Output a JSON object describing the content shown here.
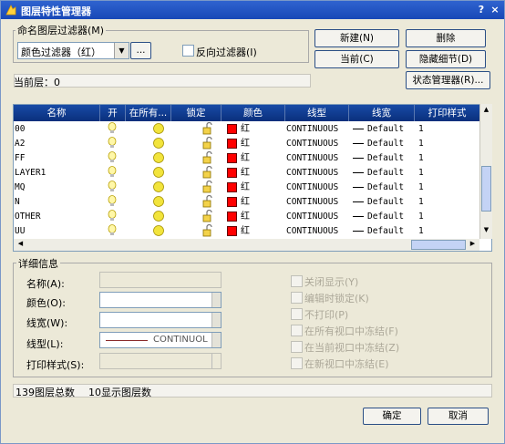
{
  "window": {
    "title": "图层特性管理器",
    "help": "?",
    "close": "×"
  },
  "filters": {
    "group_label": "命名图层过滤器(M)",
    "selected": "颜色过滤器（红）",
    "browse_label": "...",
    "invert_label": "反向过滤器(I)"
  },
  "buttons": {
    "new": "新建(N)",
    "delete": "删除",
    "current": "当前(C)",
    "hide_details": "隐藏细节(D)",
    "state_manager": "状态管理器(R)...",
    "ok": "确定",
    "cancel": "取消"
  },
  "current_layer_text": "当前层：0",
  "grid": {
    "columns": [
      "名称",
      "开",
      "在所有...",
      "锁定",
      "颜色",
      "线型",
      "线宽",
      "打印样式"
    ],
    "rows": [
      {
        "name": "00",
        "color": "红",
        "linetype": "CONTINUOUS",
        "lineweight": "Default",
        "plot": "1"
      },
      {
        "name": "A2",
        "color": "红",
        "linetype": "CONTINUOUS",
        "lineweight": "Default",
        "plot": "1"
      },
      {
        "name": "FF",
        "color": "红",
        "linetype": "CONTINUOUS",
        "lineweight": "Default",
        "plot": "1"
      },
      {
        "name": "LAYER1",
        "color": "红",
        "linetype": "CONTINUOUS",
        "lineweight": "Default",
        "plot": "1"
      },
      {
        "name": "MQ",
        "color": "红",
        "linetype": "CONTINUOUS",
        "lineweight": "Default",
        "plot": "1"
      },
      {
        "name": "N",
        "color": "红",
        "linetype": "CONTINUOUS",
        "lineweight": "Default",
        "plot": "1"
      },
      {
        "name": "OTHER",
        "color": "红",
        "linetype": "CONTINUOUS",
        "lineweight": "Default",
        "plot": "1"
      },
      {
        "name": "UU",
        "color": "红",
        "linetype": "CONTINUOUS",
        "lineweight": "Default",
        "plot": "1"
      }
    ]
  },
  "details": {
    "group_label": "详细信息",
    "name_label": "名称(A):",
    "color_label": "颜色(O):",
    "lineweight_label": "线宽(W):",
    "linetype_label": "线型(L):",
    "linetype_value": "CONTINUOL",
    "plotstyle_label": "打印样式(S):",
    "checks": [
      "关闭显示(Y)",
      "编辑时锁定(K)",
      "不打印(P)",
      "在所有视口中冻结(F)",
      "在当前视口中冻结(Z)",
      "在新视口中冻结(E)"
    ]
  },
  "status": {
    "total": "139图层总数",
    "shown": "10显示图层数"
  },
  "colors": {
    "red": "#ff0000",
    "title_bar": "#1f55c6",
    "header": "#0e3a8e",
    "bulb": "#f0e040"
  }
}
